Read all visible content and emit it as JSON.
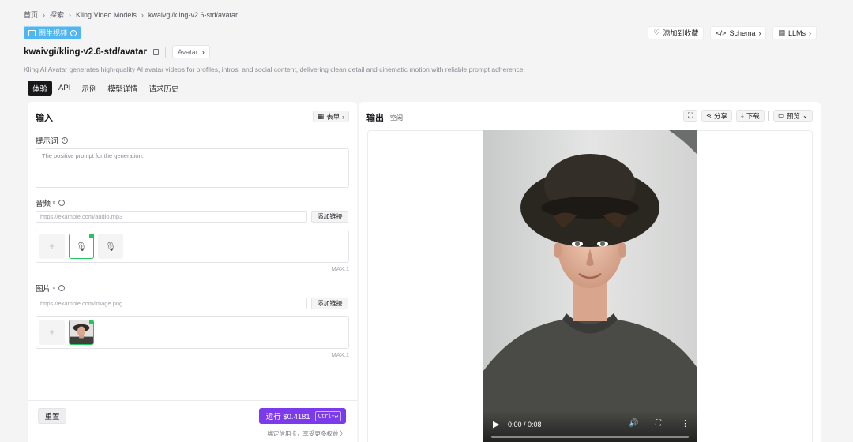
{
  "breadcrumb": [
    "首页",
    "探索",
    "Kling Video Models",
    "kwaivgi/kling-v2.6-std/avatar"
  ],
  "badge": {
    "label": "图生视频"
  },
  "actions": {
    "favorite": "添加到收藏",
    "schema": "Schema",
    "llms": "LLMs"
  },
  "model": {
    "name": "kwaivgi/kling-v2.6-std/avatar",
    "tag": "Avatar"
  },
  "description": "Kling AI Avatar generates high-quality AI avatar videos for profiles, intros, and social content, delivering clean detail and cinematic motion with reliable prompt adherence.",
  "tabs": [
    "体验",
    "API",
    "示例",
    "模型详情",
    "请求历史"
  ],
  "input": {
    "title": "输入",
    "form_button": "表单",
    "prompt": {
      "label": "提示词",
      "placeholder": "The positive prompt for the generation."
    },
    "audio": {
      "label": "音频 *",
      "placeholder": "https://example.com/audio.mp3",
      "add_link": "添加链接",
      "max": "MAX:1"
    },
    "image": {
      "label": "图片 *",
      "placeholder": "https://example.com/image.png",
      "add_link": "添加链接",
      "max": "MAX:1"
    },
    "plus": "+"
  },
  "footer": {
    "reset": "重置",
    "run": "运行 $0.4181",
    "shortcut": "Ctrl+↵",
    "hint": "绑定信用卡，享受更多权益 〉"
  },
  "output": {
    "title": "输出",
    "status": "空闲",
    "share": "分享",
    "download": "下载",
    "preview": "预览"
  },
  "video": {
    "time": "0:00 / 0:08",
    "progress": 0
  },
  "colors": {
    "accent": "#7c3aed",
    "badge": "#4fb6f2",
    "selected": "#22c55e"
  },
  "icons": [
    "heart-icon",
    "code-icon",
    "document-icon",
    "copy-icon",
    "info-icon",
    "table-icon",
    "mic-icon",
    "expand-icon",
    "share-icon",
    "download-icon",
    "video-icon",
    "play-icon",
    "volume-icon",
    "fullscreen-icon",
    "more-icon"
  ]
}
